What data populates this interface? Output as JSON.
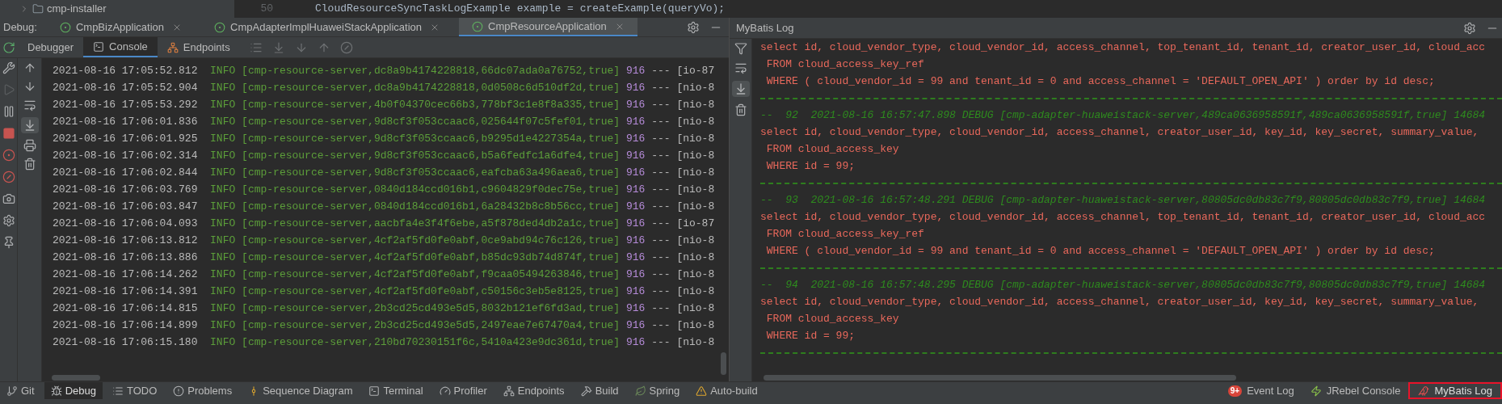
{
  "editor": {
    "tree_item": "cmp-installer",
    "line_number": "50",
    "code_line": "CloudResourceSyncTaskLogExample example = createExample(queryVo);"
  },
  "debug_panel": {
    "label": "Debug:",
    "run_tabs": [
      {
        "label": "CmpBizApplication",
        "selected": false
      },
      {
        "label": "CmpAdapterImplHuaweiStackApplication",
        "selected": false
      },
      {
        "label": "CmpResourceApplication",
        "selected": true
      }
    ],
    "sub_tabs": [
      {
        "label": "Debugger",
        "kind": "plain",
        "selected": false
      },
      {
        "label": "Console",
        "kind": "console",
        "selected": true
      },
      {
        "label": "Endpoints",
        "kind": "endpoints",
        "selected": false
      }
    ],
    "scroll_to_end": {
      "on": true
    },
    "log_lines": [
      {
        "time": "2021-08-16 17:05:52.812",
        "level": "INFO",
        "context": "[cmp-resource-server,dc8a9b4174228818,66dc07ada0a76752,true]",
        "pid": "916",
        "thread": "--- [io-87"
      },
      {
        "time": "2021-08-16 17:05:52.904",
        "level": "INFO",
        "context": "[cmp-resource-server,dc8a9b4174228818,0d0508c6d510df2d,true]",
        "pid": "916",
        "thread": "--- [nio-8"
      },
      {
        "time": "2021-08-16 17:05:53.292",
        "level": "INFO",
        "context": "[cmp-resource-server,4b0f04370cec66b3,778bf3c1e8f8a335,true]",
        "pid": "916",
        "thread": "--- [nio-8"
      },
      {
        "time": "2021-08-16 17:06:01.836",
        "level": "INFO",
        "context": "[cmp-resource-server,9d8cf3f053ccaac6,025644f07c5fef01,true]",
        "pid": "916",
        "thread": "--- [nio-8"
      },
      {
        "time": "2021-08-16 17:06:01.925",
        "level": "INFO",
        "context": "[cmp-resource-server,9d8cf3f053ccaac6,b9295d1e4227354a,true]",
        "pid": "916",
        "thread": "--- [nio-8"
      },
      {
        "time": "2021-08-16 17:06:02.314",
        "level": "INFO",
        "context": "[cmp-resource-server,9d8cf3f053ccaac6,b5a6fedfc1a6dfe4,true]",
        "pid": "916",
        "thread": "--- [nio-8"
      },
      {
        "time": "2021-08-16 17:06:02.844",
        "level": "INFO",
        "context": "[cmp-resource-server,9d8cf3f053ccaac6,eafcba63a496aea6,true]",
        "pid": "916",
        "thread": "--- [nio-8"
      },
      {
        "time": "2021-08-16 17:06:03.769",
        "level": "INFO",
        "context": "[cmp-resource-server,0840d184ccd016b1,c9604829f0dec75e,true]",
        "pid": "916",
        "thread": "--- [nio-8"
      },
      {
        "time": "2021-08-16 17:06:03.847",
        "level": "INFO",
        "context": "[cmp-resource-server,0840d184ccd016b1,6a28432b8c8b56cc,true]",
        "pid": "916",
        "thread": "--- [nio-8"
      },
      {
        "time": "2021-08-16 17:06:04.093",
        "level": "INFO",
        "context": "[cmp-resource-server,aacbfa4e3f4f6ebe,a5f878ded4db2a1c,true]",
        "pid": "916",
        "thread": "--- [io-87"
      },
      {
        "time": "2021-08-16 17:06:13.812",
        "level": "INFO",
        "context": "[cmp-resource-server,4cf2af5fd0fe0abf,0ce9abd94c76c126,true]",
        "pid": "916",
        "thread": "--- [nio-8"
      },
      {
        "time": "2021-08-16 17:06:13.886",
        "level": "INFO",
        "context": "[cmp-resource-server,4cf2af5fd0fe0abf,b85dc93db74d874f,true]",
        "pid": "916",
        "thread": "--- [nio-8"
      },
      {
        "time": "2021-08-16 17:06:14.262",
        "level": "INFO",
        "context": "[cmp-resource-server,4cf2af5fd0fe0abf,f9caa05494263846,true]",
        "pid": "916",
        "thread": "--- [nio-8"
      },
      {
        "time": "2021-08-16 17:06:14.391",
        "level": "INFO",
        "context": "[cmp-resource-server,4cf2af5fd0fe0abf,c50156c3eb5e8125,true]",
        "pid": "916",
        "thread": "--- [nio-8"
      },
      {
        "time": "2021-08-16 17:06:14.815",
        "level": "INFO",
        "context": "[cmp-resource-server,2b3cd25cd493e5d5,8032b121ef6fd3ad,true]",
        "pid": "916",
        "thread": "--- [nio-8"
      },
      {
        "time": "2021-08-16 17:06:14.899",
        "level": "INFO",
        "context": "[cmp-resource-server,2b3cd25cd493e5d5,2497eae7e67470a4,true]",
        "pid": "916",
        "thread": "--- [nio-8"
      },
      {
        "time": "2021-08-16 17:06:15.180",
        "level": "INFO",
        "context": "[cmp-resource-server,210bd70230151f6c,5410a423e9dc361d,true]",
        "pid": "916",
        "thread": "--- [nio-8"
      }
    ]
  },
  "mybatis_panel": {
    "title": "MyBatis Log",
    "scroll_to_end": {
      "on": true
    },
    "lines": [
      {
        "kind": "sql",
        "text": "select id, cloud_vendor_type, cloud_vendor_id, access_channel, top_tenant_id, tenant_id, creator_user_id, cloud_acc"
      },
      {
        "kind": "sql",
        "text": " FROM cloud_access_key_ref"
      },
      {
        "kind": "sql",
        "text": " WHERE ( cloud_vendor_id = 99 and tenant_id = 0 and access_channel = 'DEFAULT_OPEN_API' ) order by id desc;"
      },
      {
        "kind": "separator"
      },
      {
        "kind": "header",
        "text": "--  92  2021-08-16 16:57:47.898 DEBUG [cmp-adapter-huaweistack-server,489ca0636958591f,489ca0636958591f,true] 14684"
      },
      {
        "kind": "sql",
        "text": "select id, cloud_vendor_type, cloud_vendor_id, access_channel, creator_user_id, key_id, key_secret, summary_value,"
      },
      {
        "kind": "sql",
        "text": " FROM cloud_access_key"
      },
      {
        "kind": "sql",
        "text": " WHERE id = 99;"
      },
      {
        "kind": "separator"
      },
      {
        "kind": "header",
        "text": "--  93  2021-08-16 16:57:48.291 DEBUG [cmp-adapter-huaweistack-server,80805dc0db83c7f9,80805dc0db83c7f9,true] 14684"
      },
      {
        "kind": "sql",
        "text": "select id, cloud_vendor_type, cloud_vendor_id, access_channel, top_tenant_id, tenant_id, creator_user_id, cloud_acc"
      },
      {
        "kind": "sql",
        "text": " FROM cloud_access_key_ref"
      },
      {
        "kind": "sql",
        "text": " WHERE ( cloud_vendor_id = 99 and tenant_id = 0 and access_channel = 'DEFAULT_OPEN_API' ) order by id desc;"
      },
      {
        "kind": "separator"
      },
      {
        "kind": "header",
        "text": "--  94  2021-08-16 16:57:48.295 DEBUG [cmp-adapter-huaweistack-server,80805dc0db83c7f9,80805dc0db83c7f9,true] 14684"
      },
      {
        "kind": "sql",
        "text": "select id, cloud_vendor_type, cloud_vendor_id, access_channel, creator_user_id, key_id, key_secret, summary_value,"
      },
      {
        "kind": "sql",
        "text": " FROM cloud_access_key"
      },
      {
        "kind": "sql",
        "text": " WHERE id = 99;"
      },
      {
        "kind": "separator"
      }
    ]
  },
  "bottom_tools": [
    {
      "kind": "git",
      "label": "Git",
      "selected": false
    },
    {
      "kind": "debug",
      "label": "Debug",
      "selected": true
    },
    {
      "kind": "todo",
      "label": "TODO",
      "selected": false
    },
    {
      "kind": "problems",
      "label": "Problems",
      "selected": false
    },
    {
      "kind": "sequence",
      "label": "Sequence Diagram",
      "selected": false
    },
    {
      "kind": "terminal",
      "label": "Terminal",
      "selected": false
    },
    {
      "kind": "profiler",
      "label": "Profiler",
      "selected": false
    },
    {
      "kind": "endpoints",
      "label": "Endpoints",
      "selected": false
    },
    {
      "kind": "build",
      "label": "Build",
      "selected": false
    },
    {
      "kind": "spring",
      "label": "Spring",
      "selected": false
    },
    {
      "kind": "autobuild",
      "label": "Auto-build",
      "selected": false
    }
  ],
  "bottom_tools_right": [
    {
      "kind": "eventlog",
      "label": "Event Log",
      "badge": "9+",
      "highlighted": false
    },
    {
      "kind": "jrebel",
      "label": "JRebel Console",
      "highlighted": false
    },
    {
      "kind": "mybatis",
      "label": "MyBatis Log",
      "highlighted": true
    }
  ]
}
